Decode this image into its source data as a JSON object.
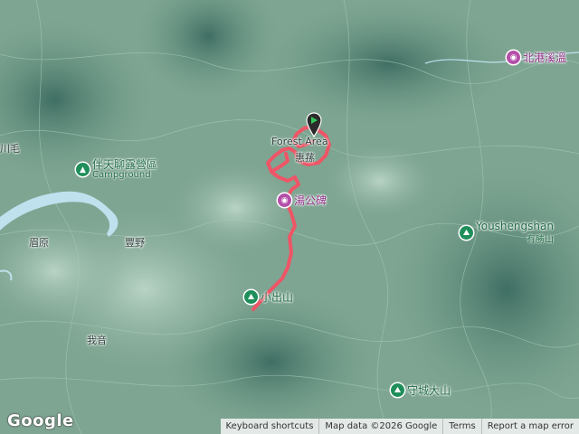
{
  "map": {
    "colors": {
      "terrain": "#6f9a86",
      "route": "#ee5566",
      "river": "#bfe1ee",
      "poi_green": "#1e8e5a",
      "poi_purple": "#b44fa8"
    },
    "icons": {
      "start_marker": "map-pin-icon",
      "campground": "tent-icon",
      "peak": "mountain-icon",
      "hot_spring": "camera-icon",
      "monument": "camera-icon"
    }
  },
  "labels": {
    "beigangxi_hot_spring": "北港溪溫",
    "campground_name": "伴天聊露營區",
    "campground_sub": "Campground",
    "tang_monument": "湯公碑",
    "youshengshan_en": "Youshengshan",
    "youshengshan_zh": "有勝山",
    "xiaochushan": "小出山",
    "shouchengdashan": "守城大山",
    "forest_area": "Forest Area",
    "huisun": "惠蓀",
    "meiyuan": "眉原",
    "fengye": "豐野",
    "woyin": "我音",
    "mao": "川毛"
  },
  "footer": {
    "logo": "Google",
    "keyboard": "Keyboard shortcuts",
    "mapdata": "Map data ©2026 Google",
    "terms": "Terms",
    "report": "Report a map error"
  }
}
